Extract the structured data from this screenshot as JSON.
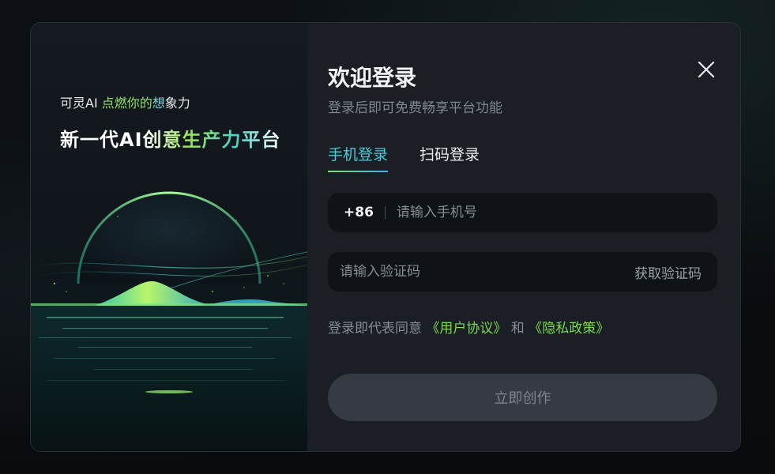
{
  "hero": {
    "slogan_prefix": "可灵AI ",
    "slogan_highlight": "点燃你的",
    "slogan_highlight2": "想",
    "slogan_suffix": "象力",
    "title": "新一代AI创意生产力平台"
  },
  "login": {
    "title": "欢迎登录",
    "subtitle": "登录后即可免费畅享平台功能",
    "tabs": [
      {
        "label": "手机登录",
        "active": true
      },
      {
        "label": "扫码登录",
        "active": false
      }
    ],
    "phone": {
      "prefix": "+86",
      "placeholder": "请输入手机号",
      "value": ""
    },
    "code": {
      "placeholder": "请输入验证码",
      "value": "",
      "get_code_label": "获取验证码"
    },
    "agreement": {
      "prefix": "登录即代表同意 ",
      "user_agreement": "《用户协议》",
      "conjunction": " 和 ",
      "privacy_policy": "《隐私政策》"
    },
    "submit_label": "立即创作"
  },
  "icons": {
    "close": "close-icon"
  },
  "colors": {
    "accent_tab": "#4ec7d6",
    "link_green": "#79d94f",
    "panel_bg": "#1b1f25",
    "input_bg": "#0f1217"
  }
}
